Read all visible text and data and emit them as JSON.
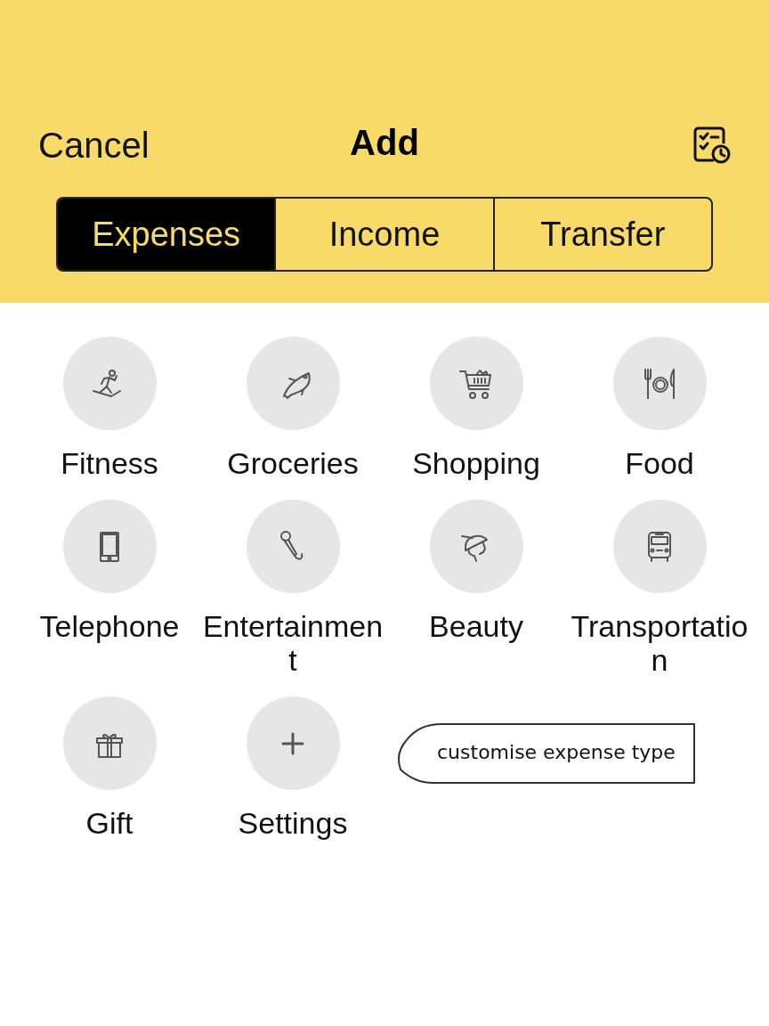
{
  "header": {
    "cancel": "Cancel",
    "title": "Add"
  },
  "tabs": [
    {
      "label": "Expenses",
      "selected": true
    },
    {
      "label": "Income",
      "selected": false
    },
    {
      "label": "Transfer",
      "selected": false
    }
  ],
  "categories": [
    {
      "label": "Fitness"
    },
    {
      "label": "Groceries"
    },
    {
      "label": "Shopping"
    },
    {
      "label": "Food"
    },
    {
      "label": "Telephone"
    },
    {
      "label": "Entertainment"
    },
    {
      "label": "Beauty"
    },
    {
      "label": "Transportation"
    },
    {
      "label": "Gift"
    },
    {
      "label": "Settings"
    }
  ],
  "tooltip": "customise expense type"
}
